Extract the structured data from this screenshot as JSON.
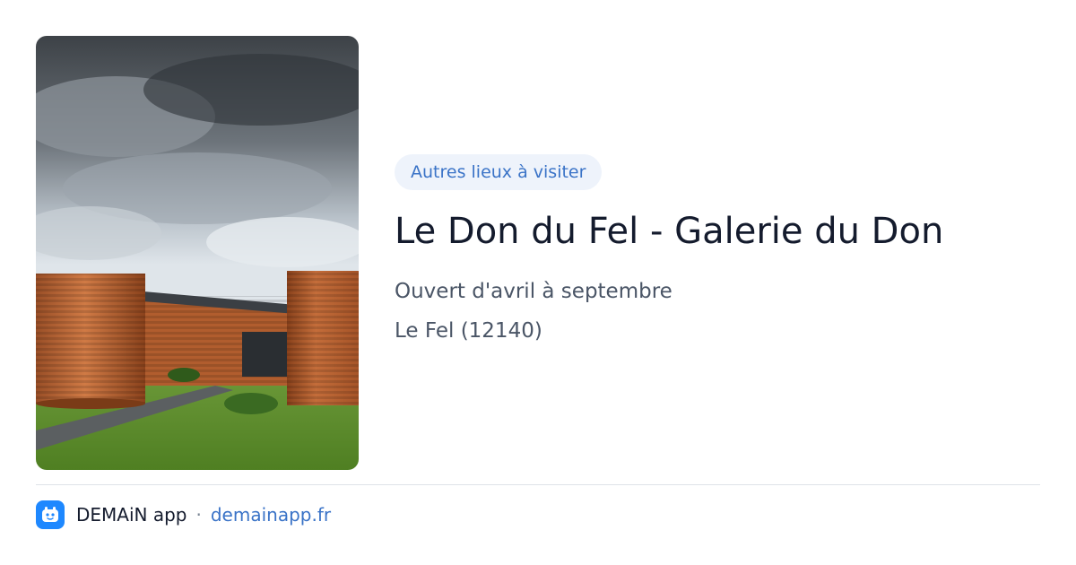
{
  "card": {
    "category_badge": "Autres lieux à visiter",
    "title": "Le Don du Fel - Galerie du Don",
    "schedule": "Ouvert d'avril à septembre",
    "location": "Le Fel (12140)",
    "photo_icon": "gallery-building-photo"
  },
  "footer": {
    "app_name": "DEMAiN app",
    "separator": "·",
    "domain": "demainapp.fr",
    "logo_icon": "demain-logo-icon"
  },
  "colors": {
    "accent": "#3a73c7",
    "badge_bg": "#eef3fb",
    "title": "#141b2d",
    "meta": "#4a5566",
    "logo": "#1e88ff"
  }
}
